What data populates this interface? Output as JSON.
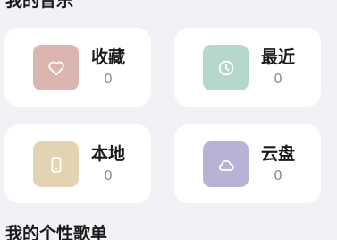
{
  "sections": {
    "my_music_title": "我的音乐",
    "playlists_title": "我的个性歌单"
  },
  "cards": [
    {
      "label": "收藏",
      "count": "0",
      "icon": "heart-icon",
      "color": "#dcb5b1"
    },
    {
      "label": "最近",
      "count": "0",
      "icon": "clock-icon",
      "color": "#b6d7cc"
    },
    {
      "label": "本地",
      "count": "0",
      "icon": "phone-icon",
      "color": "#e2d3b2"
    },
    {
      "label": "云盘",
      "count": "0",
      "icon": "cloud-icon",
      "color": "#b6b3d6"
    }
  ]
}
